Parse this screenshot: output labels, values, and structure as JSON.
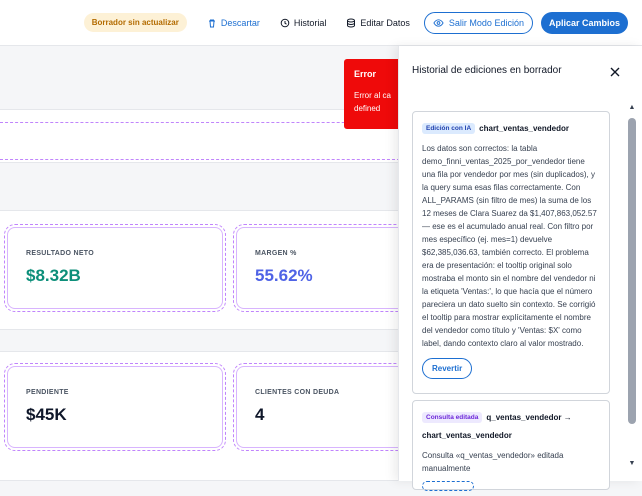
{
  "toolbar": {
    "draft_badge": "Borrador sin actualizar",
    "discard_label": "Descartar",
    "history_label": "Historial",
    "edit_data_label": "Editar Datos",
    "exit_edit_label": "Salir Modo Edición",
    "apply_label": "Aplicar Cambios"
  },
  "error_toast": {
    "title": "Error",
    "message_line1": "Error al ca",
    "message_line2": "defined"
  },
  "kpis": [
    {
      "label": "RESULTADO NETO",
      "value": "$8.32B",
      "color": "#0d8f7a"
    },
    {
      "label": "MARGEN %",
      "value": "55.62%",
      "color": "#4f63e6"
    },
    {
      "label": "PENDIENTE",
      "value": "$45K",
      "color": "#0f172a"
    },
    {
      "label": "CLIENTES CON DEUDA",
      "value": "4",
      "color": "#0f172a"
    }
  ],
  "panel": {
    "title": "Historial de ediciones en borrador",
    "entries": [
      {
        "tag": "Edición con IA",
        "title": "chart_ventas_vendedor",
        "body": "Los datos son correctos: la tabla demo_finni_ventas_2025_por_vendedor tiene una fila por vendedor por mes (sin duplicados), y la query suma esas filas correctamente. Con ALL_PARAMS (sin filtro de mes) la suma de los 12 meses de Clara Suarez da $1,407,863,052.57 — ese es el acumulado anual real. Con filtro por mes específico (ej. mes=1) devuelve $62,385,036.63, también correcto. El problema era de presentación: el tooltip original solo mostraba el monto sin el nombre del vendedor ni la etiqueta 'Ventas:', lo que hacía que el número pareciera un dato suelto sin contexto. Se corrigió el tooltip para mostrar explícitamente el nombre del vendedor como título y 'Ventas: $X' como label, dando contexto claro al valor mostrado.",
        "revert_label": "Revertir"
      },
      {
        "tag": "Consulta editada",
        "title": "q_ventas_vendedor → chart_ventas_vendedor",
        "body": "Consulta «q_ventas_vendedor» editada manualmente"
      }
    ]
  }
}
